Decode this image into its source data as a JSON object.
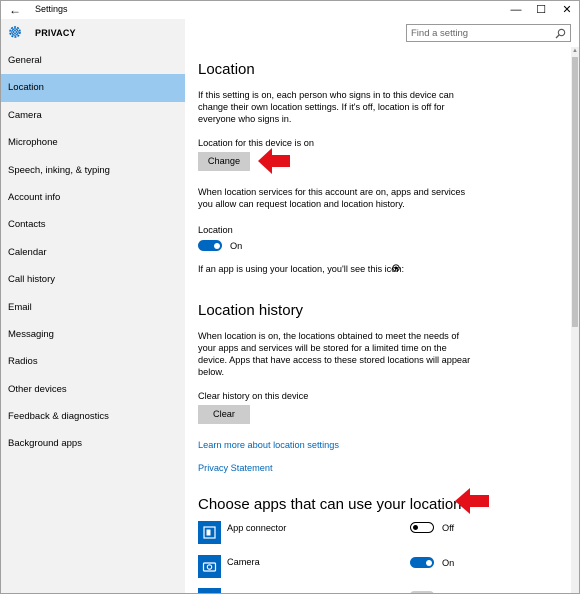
{
  "window": {
    "title": "Settings",
    "back_glyph": "←",
    "min_glyph": "—",
    "max_glyph": "☐",
    "close_glyph": "✕"
  },
  "sidebar": {
    "heading": "PRIVACY",
    "items": [
      {
        "label": "General"
      },
      {
        "label": "Location"
      },
      {
        "label": "Camera"
      },
      {
        "label": "Microphone"
      },
      {
        "label": "Speech, inking, & typing"
      },
      {
        "label": "Account info"
      },
      {
        "label": "Contacts"
      },
      {
        "label": "Calendar"
      },
      {
        "label": "Call history"
      },
      {
        "label": "Email"
      },
      {
        "label": "Messaging"
      },
      {
        "label": "Radios"
      },
      {
        "label": "Other devices"
      },
      {
        "label": "Feedback & diagnostics"
      },
      {
        "label": "Background apps"
      }
    ]
  },
  "search": {
    "placeholder": "Find a setting"
  },
  "location": {
    "title": "Location",
    "intro_1": "If this setting is on, each person who signs in to this device can",
    "intro_2": "change their own location settings. If it's off, location is off for",
    "intro_3": "everyone who signs in.",
    "device_status": "Location for this device is on",
    "change_label": "Change",
    "account_1": "When location services for this account are on, apps and services",
    "account_2": "you allow can request location and location history.",
    "toggle_label": "Location",
    "toggle_state": "On",
    "icon_hint": "If an app is using your location, you'll see this icon:"
  },
  "history": {
    "title": "Location history",
    "text_1": "When location is on, the locations obtained to meet the needs of",
    "text_2": "your apps and services will be stored for a limited time on the",
    "text_3": "device. Apps that have access to these stored locations will appear",
    "text_4": "below.",
    "clear_label": "Clear history on this device",
    "clear_button": "Clear",
    "learn_more": "Learn more about location settings",
    "privacy_statement": "Privacy Statement"
  },
  "apps": {
    "title": "Choose apps that can use your location",
    "list": [
      {
        "name": "App connector",
        "state": "Off"
      },
      {
        "name": "Camera",
        "state": "On"
      }
    ]
  },
  "colors": {
    "accent": "#0067c0",
    "sidebar_active": "#99c9ef",
    "arrow": "#e3101a"
  }
}
